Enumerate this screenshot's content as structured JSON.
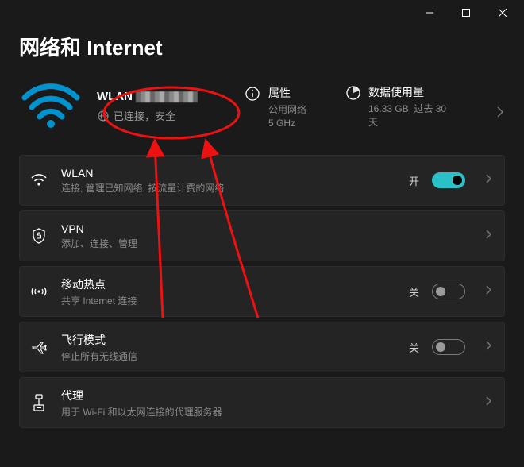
{
  "titlebar": {
    "minimize": "—",
    "maximize": "□",
    "close": "×"
  },
  "page": {
    "title": "网络和 Internet"
  },
  "hero": {
    "ssid_prefix": "WLAN",
    "status": "已连接，安全",
    "properties": {
      "label": "属性",
      "sub1": "公用网络",
      "sub2": "5 GHz"
    },
    "data_usage": {
      "label": "数据使用量",
      "sub": "16.33 GB, 过去 30 天"
    }
  },
  "rows": {
    "wlan": {
      "title": "WLAN",
      "sub": "连接, 管理已知网络, 按流量计费的网络",
      "state": "开"
    },
    "vpn": {
      "title": "VPN",
      "sub": "添加、连接、管理"
    },
    "hotspot": {
      "title": "移动热点",
      "sub": "共享 Internet 连接",
      "state": "关"
    },
    "airplane": {
      "title": "飞行模式",
      "sub": "停止所有无线通信",
      "state": "关"
    },
    "proxy": {
      "title": "代理",
      "sub": "用于 Wi-Fi 和以太网连接的代理服务器"
    }
  }
}
